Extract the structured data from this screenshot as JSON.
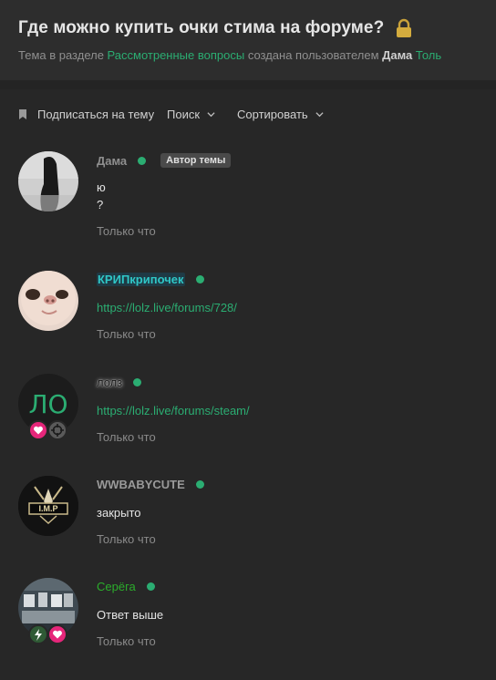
{
  "header": {
    "title": "Где можно купить очки стима на форуме?",
    "meta_prefix": "Тема в разделе ",
    "section_link": "Рассмотренные вопросы",
    "meta_middle": " создана пользователем ",
    "author": "Дама",
    "tail": " Толь"
  },
  "toolbar": {
    "subscribe_label": "Подписаться на тему",
    "search_label": "Поиск",
    "sort_label": "Сортировать"
  },
  "posts": [
    {
      "username": "Дама",
      "username_color": "#8f8f8f",
      "badge": "Автор темы",
      "content_line1": "ю",
      "content_line2": "?",
      "time": "Только что"
    },
    {
      "username": "КРИПкрипочек",
      "username_color": "#2fc7c7",
      "content": "https://lolz.live/forums/728/",
      "time": "Только что"
    },
    {
      "username": "лолз",
      "username_color": "#ffffff",
      "avatar_text": "ЛО",
      "content": "https://lolz.live/forums/steam/",
      "time": "Только что"
    },
    {
      "username": "WWBABYCUTE",
      "username_color": "#9a9a9a",
      "avatar_text": "I.M.P",
      "content": "закрыто",
      "time": "Только что"
    },
    {
      "username": "Серёга",
      "username_color": "#2bad2b",
      "content": "Ответ выше",
      "time": "Только что"
    }
  ],
  "colors": {
    "accent_green": "#2bad72",
    "background": "#272727",
    "header_bg": "#2d2d2d"
  }
}
